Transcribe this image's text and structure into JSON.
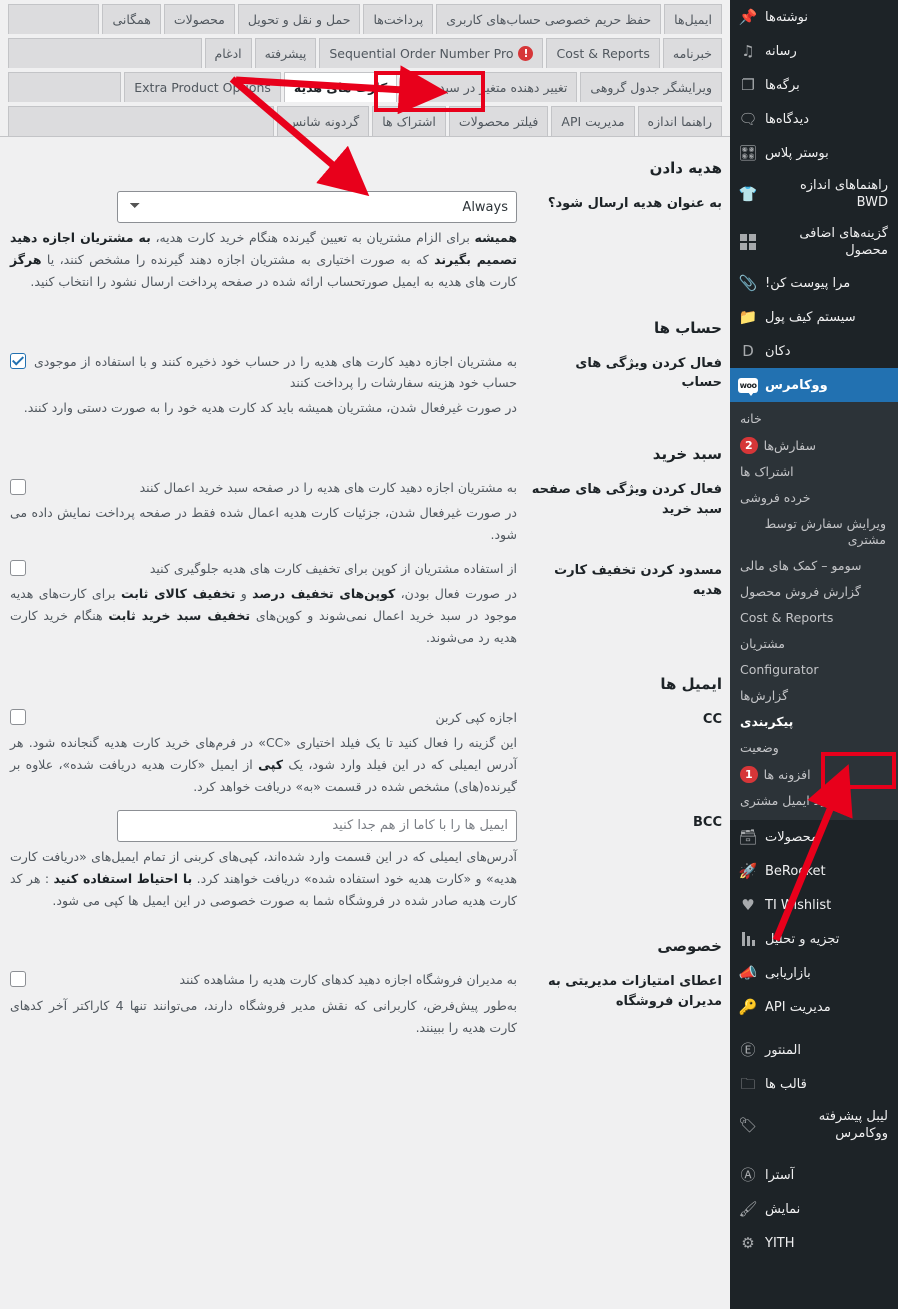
{
  "sidebar": {
    "items": [
      {
        "label": "نوشته‌ها",
        "icon": "pin-icon"
      },
      {
        "label": "رسانه",
        "icon": "media-icon"
      },
      {
        "label": "برگه‌ها",
        "icon": "pages-icon"
      },
      {
        "label": "دیدگاه‌ها",
        "icon": "comment-icon"
      },
      {
        "label": "بوستر پلاس",
        "icon": "sliders-icon"
      },
      {
        "label": "راهنماهای اندازه BWD",
        "icon": "tshirt-icon"
      },
      {
        "label": "گزینه‌های اضافی محصول",
        "icon": "grid-icon"
      },
      {
        "label": "مرا پیوست کن!",
        "icon": "paperclip-icon"
      },
      {
        "label": "سیستم کیف پول",
        "icon": "wallet-icon"
      },
      {
        "label": "دکان",
        "icon": "dokan-icon"
      }
    ],
    "woocommerce": {
      "label": "ووکامرس",
      "icon": "woo-icon"
    },
    "woo_submenu": [
      {
        "label": "خانه",
        "badge": null,
        "active": false
      },
      {
        "label": "سفارش‌ها",
        "badge": "2",
        "active": false
      },
      {
        "label": "اشتراک ها",
        "badge": null,
        "active": false
      },
      {
        "label": "خرده فروشی",
        "badge": null,
        "active": false
      },
      {
        "label": "ویرایش سفارش توسط مشتری",
        "badge": null,
        "active": false
      },
      {
        "label": "سومو – کمک های مالی",
        "badge": null,
        "active": false
      },
      {
        "label": "گزارش فروش محصول",
        "badge": null,
        "active": false
      },
      {
        "label": "Cost & Reports",
        "badge": null,
        "active": false
      },
      {
        "label": "مشتریان",
        "badge": null,
        "active": false
      },
      {
        "label": "Configurator",
        "badge": null,
        "active": false
      },
      {
        "label": "گزارش‌ها",
        "badge": null,
        "active": false
      },
      {
        "label": "پیکربندی",
        "badge": null,
        "active": true
      },
      {
        "label": "وضعیت",
        "badge": null,
        "active": false
      },
      {
        "label": "افزونه ها",
        "badge": "1",
        "active": false
      },
      {
        "label": "تایید ایمیل مشتری",
        "badge": null,
        "active": false
      }
    ],
    "items_lower": [
      {
        "label": "محصولات",
        "icon": "product-icon"
      },
      {
        "label": "BeRocket",
        "icon": "rocket-icon"
      },
      {
        "label": "TI Wishlist",
        "icon": "heart-icon"
      },
      {
        "label": "تجزیه و تحلیل",
        "icon": "chart-bars-icon"
      },
      {
        "label": "بازاریابی",
        "icon": "megaphone-icon"
      },
      {
        "label": "مدیریت API",
        "icon": "key-icon"
      }
    ],
    "items_lower2": [
      {
        "label": "المنتور",
        "icon": "elementor-icon"
      },
      {
        "label": "قالب ها",
        "icon": "folder-icon"
      },
      {
        "label": "لیبل پیشرفته ووکامرس",
        "icon": "tag-icon"
      }
    ],
    "items_lower3": [
      {
        "label": "آسترا",
        "icon": "astra-icon"
      },
      {
        "label": "نمایش",
        "icon": "appearance-icon"
      },
      {
        "label": "YITH",
        "icon": "yith-icon"
      }
    ]
  },
  "tabs": {
    "row1": [
      "ایمیل‌ها",
      "حفظ حریم خصوصی حساب‌های کاربری",
      "پرداخت‌ها",
      "حمل و نقل و تحویل",
      "محصولات",
      "همگانی"
    ],
    "row2": [
      "خبرنامه",
      "Cost & Reports",
      "Sequential Order Number Pro",
      "پیشرفته",
      "ادغام"
    ],
    "row2_warning_index": 2,
    "row3": [
      "ویرایشگر جدول گروهی",
      "تغییر دهنده متغیر در سبد خرید",
      "کارت های هدیه",
      "Extra Product Options"
    ],
    "row3_active_index": 2,
    "row4": [
      "راهنما اندازه",
      "مدیریت API",
      "فیلتر محصولات",
      "اشتراک ها",
      "گردونه شانس"
    ]
  },
  "sections": {
    "gifting": {
      "title": "هدیه دادن",
      "fields": [
        {
          "label": "به عنوان هدیه ارسال شود؟",
          "type": "select",
          "value": "Always",
          "options": [
            "Always"
          ],
          "desc_parts": [
            {
              "t": "همیشه",
              "b": true
            },
            {
              "t": " برای الزام مشتریان به تعیین گیرنده هنگام خرید کارت هدیه، ",
              "b": false
            },
            {
              "t": "به مشتریان اجازه دهید تصمیم بگیرند",
              "b": true
            },
            {
              "t": " که به صورت اختیاری به مشتریان اجازه دهند گیرنده را مشخص کنند، یا ",
              "b": false
            },
            {
              "t": "هرگز",
              "b": true
            },
            {
              "t": " کارت های هدیه به ایمیل صورتحساب ارائه شده در صفحه پرداخت ارسال نشود را انتخاب کنید.",
              "b": false
            }
          ]
        }
      ]
    },
    "accounts": {
      "title": "حساب ها",
      "fields": [
        {
          "label": "فعال کردن ویژگی های حساب",
          "type": "checkbox",
          "checked": true,
          "cbtext": "به مشتریان اجازه دهید کارت های هدیه را در حساب خود ذخیره کنند و با استفاده از موجودی حساب خود هزینه سفارشات را پرداخت کنند",
          "desc_parts": [
            {
              "t": "در صورت غیرفعال شدن، مشتریان همیشه باید کد کارت هدیه خود را به صورت دستی وارد کنند.",
              "b": false
            }
          ]
        }
      ]
    },
    "cart": {
      "title": "سبد خرید",
      "fields": [
        {
          "label": "فعال کردن ویژگی های صفحه سبد خرید",
          "type": "checkbox",
          "checked": false,
          "cbtext": "به مشتریان اجازه دهید کارت های هدیه را در صفحه سبد خرید اعمال کنند",
          "desc_parts": [
            {
              "t": "در صورت غیرفعال شدن، جزئیات کارت هدیه اعمال شده فقط در صفحه پرداخت نمایش داده می شود.",
              "b": false
            }
          ]
        },
        {
          "label": "مسدود کردن تخفیف کارت هدیه",
          "type": "checkbox",
          "checked": false,
          "cbtext": "از استفاده مشتریان از کوپن برای تخفیف کارت های هدیه جلوگیری کنید",
          "desc_parts": [
            {
              "t": "در صورت فعال بودن، ",
              "b": false
            },
            {
              "t": "کوپن‌های تخفیف درصد",
              "b": true
            },
            {
              "t": " و ",
              "b": false
            },
            {
              "t": "تخفیف کالای ثابت",
              "b": true
            },
            {
              "t": " برای کارت‌های هدیه موجود در سبد خرید اعمال نمی‌شوند و کوپن‌های ",
              "b": false
            },
            {
              "t": "تخفیف سبد خرید ثابت",
              "b": true
            },
            {
              "t": " هنگام خرید کارت هدیه رد می‌شوند.",
              "b": false
            }
          ]
        }
      ]
    },
    "emails": {
      "title": "ایمیل ها",
      "fields": [
        {
          "label": "CC",
          "type": "checkbox",
          "checked": false,
          "cbtext": "اجازه کپی کربن",
          "desc_parts": [
            {
              "t": "این گزینه را فعال کنید تا یک فیلد اختیاری «CC» در فرم‌های خرید کارت هدیه گنجانده شود. هر آدرس ایمیلی که در این فیلد وارد شود، یک ",
              "b": false
            },
            {
              "t": "کپی",
              "b": true
            },
            {
              "t": " از ایمیل «کارت هدیه دریافت شده»، علاوه بر گیرنده(های) مشخص شده در قسمت «به» دریافت خواهد کرد.",
              "b": false
            }
          ]
        },
        {
          "label": "BCC",
          "type": "text",
          "value": "",
          "placeholder": "ایمیل ها را با کاما از هم جدا کنید",
          "desc_parts": [
            {
              "t": "آدرس‌های ایمیلی که در این قسمت وارد شده‌اند، کپی‌های کربنی از تمام ایمیل‌های «دریافت کارت هدیه» و «کارت هدیه خود استفاده شده» دریافت خواهند کرد. ",
              "b": false
            },
            {
              "t": "با احتیاط استفاده کنید",
              "b": true
            },
            {
              "t": " : هر کد کارت هدیه صادر شده در فروشگاه شما به صورت خصوصی در این ایمیل ها کپی می شود.",
              "b": false
            }
          ]
        }
      ]
    },
    "private": {
      "title": "خصوصی",
      "fields": [
        {
          "label": "اعطای امتیازات مدیریتی به مدیران فروشگاه",
          "type": "checkbox",
          "checked": false,
          "cbtext": "به مدیران فروشگاه اجازه دهید کدهای کارت هدیه را مشاهده کنند",
          "desc_parts": [
            {
              "t": "به‌طور پیش‌فرض، کاربرانی که نقش مدیر فروشگاه دارند، می‌توانند تنها 4 کاراکتر آخر کدهای کارت هدیه را ببینند.",
              "b": false
            }
          ]
        }
      ]
    }
  },
  "annotations": {
    "accent_color": "#e8001b",
    "highlight_tab": "کارت های هدیه",
    "highlight_menu": "پیکربندی"
  }
}
